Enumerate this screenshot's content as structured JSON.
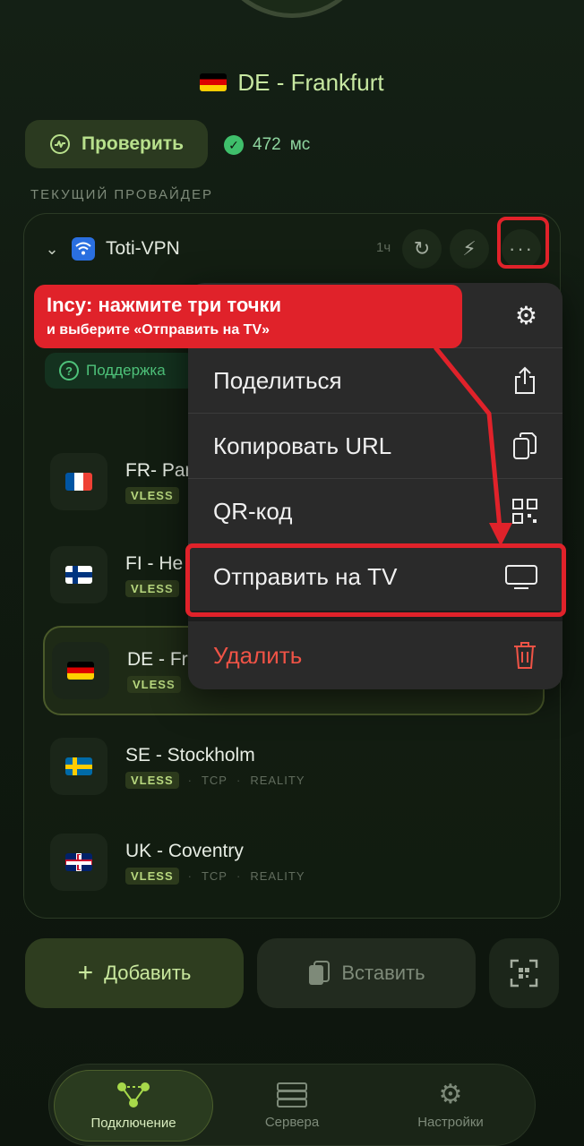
{
  "header": {
    "location": "DE - Frankfurt",
    "check_label": "Проверить",
    "ping_value": "472",
    "ping_unit": "мс"
  },
  "section_label": "ТЕКУЩИЙ ПРОВАЙДЕР",
  "provider": {
    "name": "Toti-VPN",
    "age": "1ч",
    "support_label": "Поддержка"
  },
  "servers": [
    {
      "name": "FR- Par",
      "proto": "VLESS",
      "t1": "",
      "t2": ""
    },
    {
      "name": "FI - He",
      "proto": "VLESS",
      "t1": "",
      "t2": ""
    },
    {
      "name": "DE - Fra",
      "proto": "VLESS",
      "t1": "",
      "t2": ""
    },
    {
      "name": "SE - Stockholm",
      "proto": "VLESS",
      "t1": "TCP",
      "t2": "REALITY"
    },
    {
      "name": "UK - Coventry",
      "proto": "VLESS",
      "t1": "TCP",
      "t2": "REALITY"
    }
  ],
  "actions": {
    "add_label": "Добавить",
    "paste_label": "Вставить"
  },
  "tabs": [
    {
      "label": "Подключение"
    },
    {
      "label": "Сервера"
    },
    {
      "label": "Настройки"
    }
  ],
  "menu": {
    "share": "Поделиться",
    "copy_url": "Копировать URL",
    "qr": "QR-код",
    "send_tv": "Отправить на TV",
    "delete": "Удалить"
  },
  "tutorial": {
    "line1": "Incy: нажмите три точки",
    "line2": "и выберите «Отправить на TV»",
    "accent_color": "#e0222a"
  },
  "colors": {
    "accent_green": "#b8e08c",
    "delete_red": "#ef5346"
  }
}
